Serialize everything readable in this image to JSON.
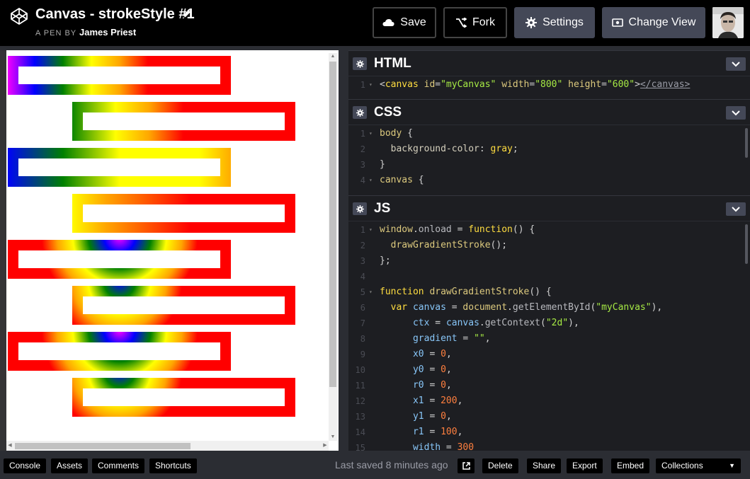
{
  "header": {
    "title": "Canvas - strokeStyle #1",
    "byline_prefix": "A PEN BY",
    "author": "James Priest",
    "buttons": {
      "save": "Save",
      "fork": "Fork",
      "settings": "Settings",
      "change_view": "Change View"
    }
  },
  "editors": {
    "html": {
      "title": "HTML",
      "lines": [
        {
          "n": "1",
          "fold": true,
          "tokens": [
            [
              "t-punc",
              "<"
            ],
            [
              "t-tag",
              "canvas"
            ],
            [
              "t-punc",
              " "
            ],
            [
              "t-attr",
              "id"
            ],
            [
              "t-punc",
              "="
            ],
            [
              "t-str",
              "\"myCanvas\""
            ],
            [
              "t-punc",
              " "
            ],
            [
              "t-attr",
              "width"
            ],
            [
              "t-punc",
              "="
            ],
            [
              "t-str",
              "\"800\""
            ],
            [
              "t-punc",
              " "
            ],
            [
              "t-attr",
              "height"
            ],
            [
              "t-punc",
              "="
            ],
            [
              "t-str",
              "\"600\""
            ],
            [
              "t-punc",
              ">"
            ],
            [
              "t-link",
              "</canvas>"
            ]
          ]
        }
      ]
    },
    "css": {
      "title": "CSS",
      "lines": [
        {
          "n": "1",
          "fold": true,
          "tokens": [
            [
              "t-sel",
              "body"
            ],
            [
              "t-punc",
              " {"
            ]
          ]
        },
        {
          "n": "2",
          "fold": false,
          "tokens": [
            [
              "t-prop",
              "  background-color"
            ],
            [
              "t-punc",
              ": "
            ],
            [
              "t-val",
              "gray"
            ],
            [
              "t-punc",
              ";"
            ]
          ]
        },
        {
          "n": "3",
          "fold": false,
          "tokens": [
            [
              "t-punc",
              "}"
            ]
          ]
        },
        {
          "n": "4",
          "fold": true,
          "tokens": [
            [
              "t-sel",
              "canvas"
            ],
            [
              "t-punc",
              " {"
            ]
          ]
        }
      ]
    },
    "js": {
      "title": "JS",
      "lines": [
        {
          "n": "1",
          "fold": true,
          "tokens": [
            [
              "t-fn",
              "window"
            ],
            [
              "t-punc",
              "."
            ],
            [
              "t-obj",
              "onload"
            ],
            [
              "t-punc",
              " = "
            ],
            [
              "t-kw",
              "function"
            ],
            [
              "t-punc",
              "() {"
            ]
          ]
        },
        {
          "n": "2",
          "fold": false,
          "tokens": [
            [
              "t-fn",
              "  drawGradientStroke"
            ],
            [
              "t-punc",
              "();"
            ]
          ]
        },
        {
          "n": "3",
          "fold": false,
          "tokens": [
            [
              "t-punc",
              "};"
            ]
          ]
        },
        {
          "n": "4",
          "fold": false,
          "tokens": [
            [
              "t-punc",
              ""
            ]
          ]
        },
        {
          "n": "5",
          "fold": true,
          "tokens": [
            [
              "t-kw",
              "function"
            ],
            [
              "t-punc",
              " "
            ],
            [
              "t-fn",
              "drawGradientStroke"
            ],
            [
              "t-punc",
              "() {"
            ]
          ]
        },
        {
          "n": "6",
          "fold": false,
          "tokens": [
            [
              "t-kw",
              "  var"
            ],
            [
              "t-punc",
              " "
            ],
            [
              "t-var",
              "canvas"
            ],
            [
              "t-punc",
              " = "
            ],
            [
              "t-fn",
              "document"
            ],
            [
              "t-punc",
              "."
            ],
            [
              "t-obj",
              "getElementById"
            ],
            [
              "t-punc",
              "("
            ],
            [
              "t-str",
              "\"myCanvas\""
            ],
            [
              "t-punc",
              "),"
            ]
          ]
        },
        {
          "n": "7",
          "fold": false,
          "tokens": [
            [
              "t-var",
              "      ctx"
            ],
            [
              "t-punc",
              " = "
            ],
            [
              "t-var",
              "canvas"
            ],
            [
              "t-punc",
              "."
            ],
            [
              "t-obj",
              "getContext"
            ],
            [
              "t-punc",
              "("
            ],
            [
              "t-str",
              "\"2d\""
            ],
            [
              "t-punc",
              "),"
            ]
          ]
        },
        {
          "n": "8",
          "fold": false,
          "tokens": [
            [
              "t-var",
              "      gradient"
            ],
            [
              "t-punc",
              " = "
            ],
            [
              "t-str",
              "\"\""
            ],
            [
              "t-punc",
              ","
            ]
          ]
        },
        {
          "n": "9",
          "fold": false,
          "tokens": [
            [
              "t-var",
              "      x0"
            ],
            [
              "t-punc",
              " = "
            ],
            [
              "t-num",
              "0"
            ],
            [
              "t-punc",
              ","
            ]
          ]
        },
        {
          "n": "10",
          "fold": false,
          "tokens": [
            [
              "t-var",
              "      y0"
            ],
            [
              "t-punc",
              " = "
            ],
            [
              "t-num",
              "0"
            ],
            [
              "t-punc",
              ","
            ]
          ]
        },
        {
          "n": "11",
          "fold": false,
          "tokens": [
            [
              "t-var",
              "      r0"
            ],
            [
              "t-punc",
              " = "
            ],
            [
              "t-num",
              "0"
            ],
            [
              "t-punc",
              ","
            ]
          ]
        },
        {
          "n": "12",
          "fold": false,
          "tokens": [
            [
              "t-var",
              "      x1"
            ],
            [
              "t-punc",
              " = "
            ],
            [
              "t-num",
              "200"
            ],
            [
              "t-punc",
              ","
            ]
          ]
        },
        {
          "n": "13",
          "fold": false,
          "tokens": [
            [
              "t-var",
              "      y1"
            ],
            [
              "t-punc",
              " = "
            ],
            [
              "t-num",
              "0"
            ],
            [
              "t-punc",
              ","
            ]
          ]
        },
        {
          "n": "14",
          "fold": false,
          "tokens": [
            [
              "t-var",
              "      r1"
            ],
            [
              "t-punc",
              " = "
            ],
            [
              "t-num",
              "100"
            ],
            [
              "t-punc",
              ","
            ]
          ]
        },
        {
          "n": "15",
          "fold": false,
          "tokens": [
            [
              "t-var",
              "      width"
            ],
            [
              "t-punc",
              " = "
            ],
            [
              "t-num",
              "300"
            ]
          ]
        }
      ]
    }
  },
  "footer": {
    "console": "Console",
    "assets": "Assets",
    "comments": "Comments",
    "shortcuts": "Shortcuts",
    "last_saved": "Last saved 8 minutes ago",
    "delete": "Delete",
    "share": "Share",
    "export": "Export",
    "embed": "Embed",
    "collections": "Collections"
  },
  "icons": {
    "logo": "codepen-logo-icon",
    "edit": "pencil-icon",
    "save": "cloud-icon",
    "fork": "fork-icon",
    "settings": "gear-icon",
    "change_view": "layout-icon",
    "external": "external-link-icon"
  },
  "colors": {
    "header_bg": "#000000",
    "editor_bg": "#1d1e22",
    "button_filled": "#444857",
    "footer_bg": "#2b2d33"
  }
}
